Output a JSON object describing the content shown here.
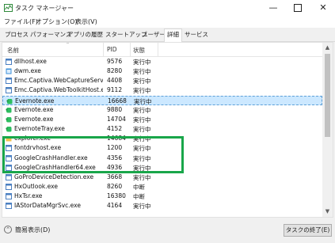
{
  "window": {
    "title": "タスク マネージャー"
  },
  "menu": [
    "ファイル(F)",
    "オプション(O)",
    "表示(V)"
  ],
  "tabs": [
    {
      "label": "プロセス",
      "active": false
    },
    {
      "label": "パフォーマンス",
      "active": false
    },
    {
      "label": "アプリの履歴",
      "active": false
    },
    {
      "label": "スタートアップ",
      "active": false
    },
    {
      "label": "ユーザー",
      "active": false
    },
    {
      "label": "詳細",
      "active": true
    },
    {
      "label": "サービス",
      "active": false
    }
  ],
  "columns": {
    "name": "名前",
    "pid": "PID",
    "status": "状態"
  },
  "rows": [
    {
      "name": "dllhost.exe",
      "pid": "9576",
      "status": "実行中",
      "icon": "default-app-icon",
      "selected": false
    },
    {
      "name": "dwm.exe",
      "pid": "8280",
      "status": "実行中",
      "icon": "window-manager-icon",
      "selected": false
    },
    {
      "name": "Emc.Captiva.WebCaptureServi...",
      "pid": "4408",
      "status": "実行中",
      "icon": "default-app-icon",
      "selected": false
    },
    {
      "name": "Emc.Captiva.WebToolkitHost.e...",
      "pid": "9112",
      "status": "実行中",
      "icon": "default-app-icon",
      "selected": false
    },
    {
      "name": "Evernote.exe",
      "pid": "16668",
      "status": "実行中",
      "icon": "evernote-icon",
      "selected": true
    },
    {
      "name": "Evernote.exe",
      "pid": "9880",
      "status": "実行中",
      "icon": "evernote-icon",
      "selected": false
    },
    {
      "name": "Evernote.exe",
      "pid": "14704",
      "status": "実行中",
      "icon": "evernote-icon",
      "selected": false
    },
    {
      "name": "EvernoteTray.exe",
      "pid": "4152",
      "status": "実行中",
      "icon": "evernote-icon",
      "selected": false
    },
    {
      "name": "explorer.exe",
      "pid": "14684",
      "status": "実行中",
      "icon": "folder-icon",
      "selected": false
    },
    {
      "name": "fontdrvhost.exe",
      "pid": "1200",
      "status": "実行中",
      "icon": "default-app-icon",
      "selected": false
    },
    {
      "name": "GoogleCrashHandler.exe",
      "pid": "4356",
      "status": "実行中",
      "icon": "default-app-icon",
      "selected": false
    },
    {
      "name": "GoogleCrashHandler64.exe",
      "pid": "4936",
      "status": "実行中",
      "icon": "default-app-icon",
      "selected": false
    },
    {
      "name": "GoProDeviceDetection.exe",
      "pid": "3668",
      "status": "実行中",
      "icon": "default-app-icon",
      "selected": false
    },
    {
      "name": "HxOutlook.exe",
      "pid": "8260",
      "status": "中断",
      "icon": "default-app-icon",
      "selected": false
    },
    {
      "name": "HxTsr.exe",
      "pid": "16380",
      "status": "中断",
      "icon": "default-app-icon",
      "selected": false
    },
    {
      "name": "IAStorDataMgrSvc.exe",
      "pid": "4164",
      "status": "実行中",
      "icon": "default-app-icon",
      "selected": false
    }
  ],
  "footer": {
    "less_details": "簡易表示(D)",
    "end_task": "タスクの終了(E)"
  },
  "colors": {
    "highlight": "#19a64a",
    "selection": "#cce8ff",
    "evernote": "#2dbe60"
  }
}
